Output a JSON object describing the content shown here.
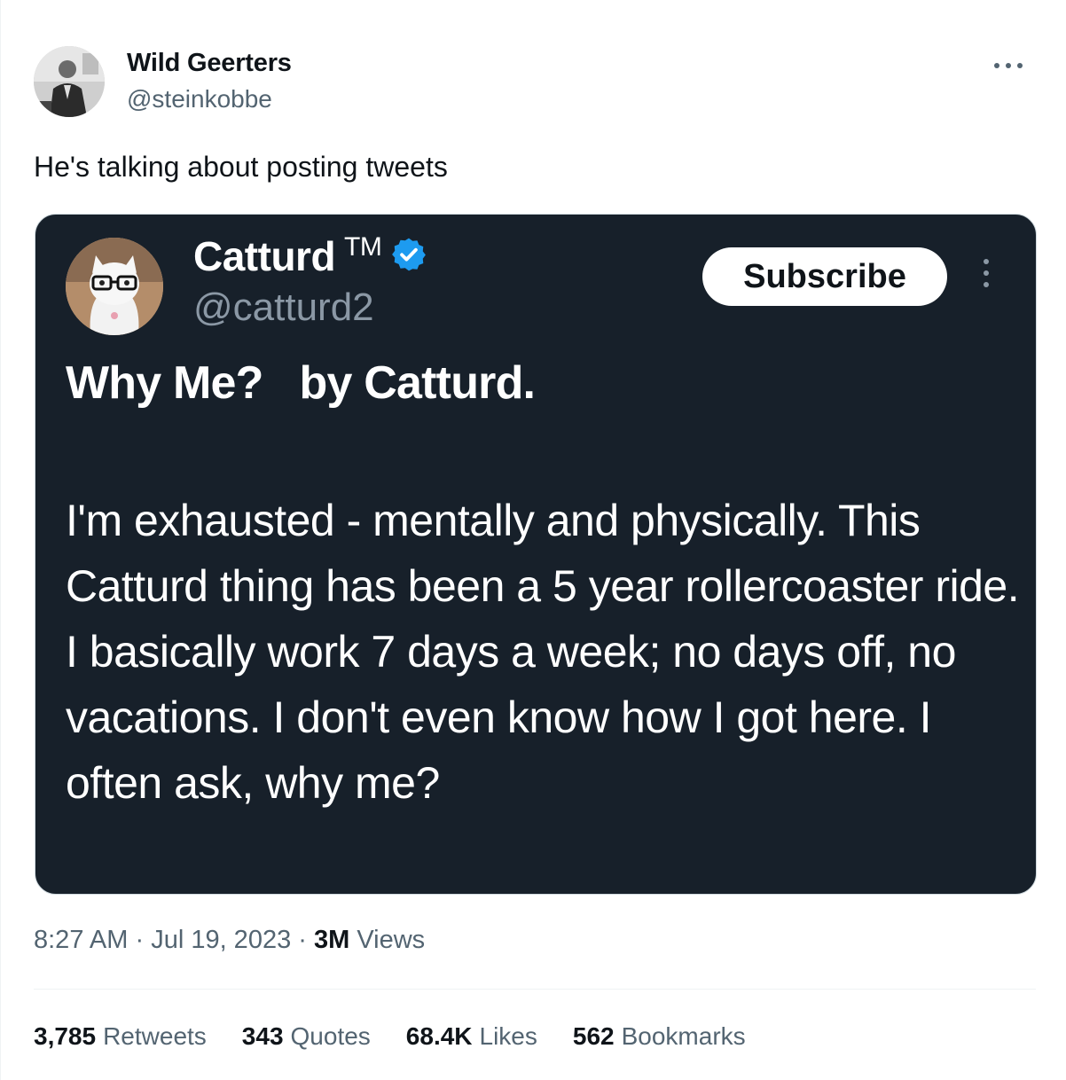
{
  "author": {
    "name": "Wild Geerters",
    "handle": "@steinkobbe"
  },
  "tweet": {
    "text": "He's talking about posting tweets"
  },
  "embed": {
    "name": "Catturd",
    "tm": "TM",
    "handle": "@catturd2",
    "subscribe_label": "Subscribe",
    "title": "Why Me?   by Catturd.",
    "body": "I'm exhausted - mentally and physically. This Catturd thing has been a 5 year rollercoaster ride. I basically work 7 days a week; no days off, no vacations. I don't even know how I got here. I often ask, why me?"
  },
  "meta": {
    "time": "8:27 AM",
    "sep1": " · ",
    "date": "Jul 19, 2023",
    "sep2": " · ",
    "views_count": "3M",
    "views_label": " Views"
  },
  "stats": [
    {
      "num": "3,785",
      "label": "Retweets"
    },
    {
      "num": "343",
      "label": "Quotes"
    },
    {
      "num": "68.4K",
      "label": "Likes"
    },
    {
      "num": "562",
      "label": "Bookmarks"
    }
  ],
  "colors": {
    "embed_bg": "#17202a",
    "verified": "#1d9bf0",
    "secondary_text": "#536471"
  }
}
